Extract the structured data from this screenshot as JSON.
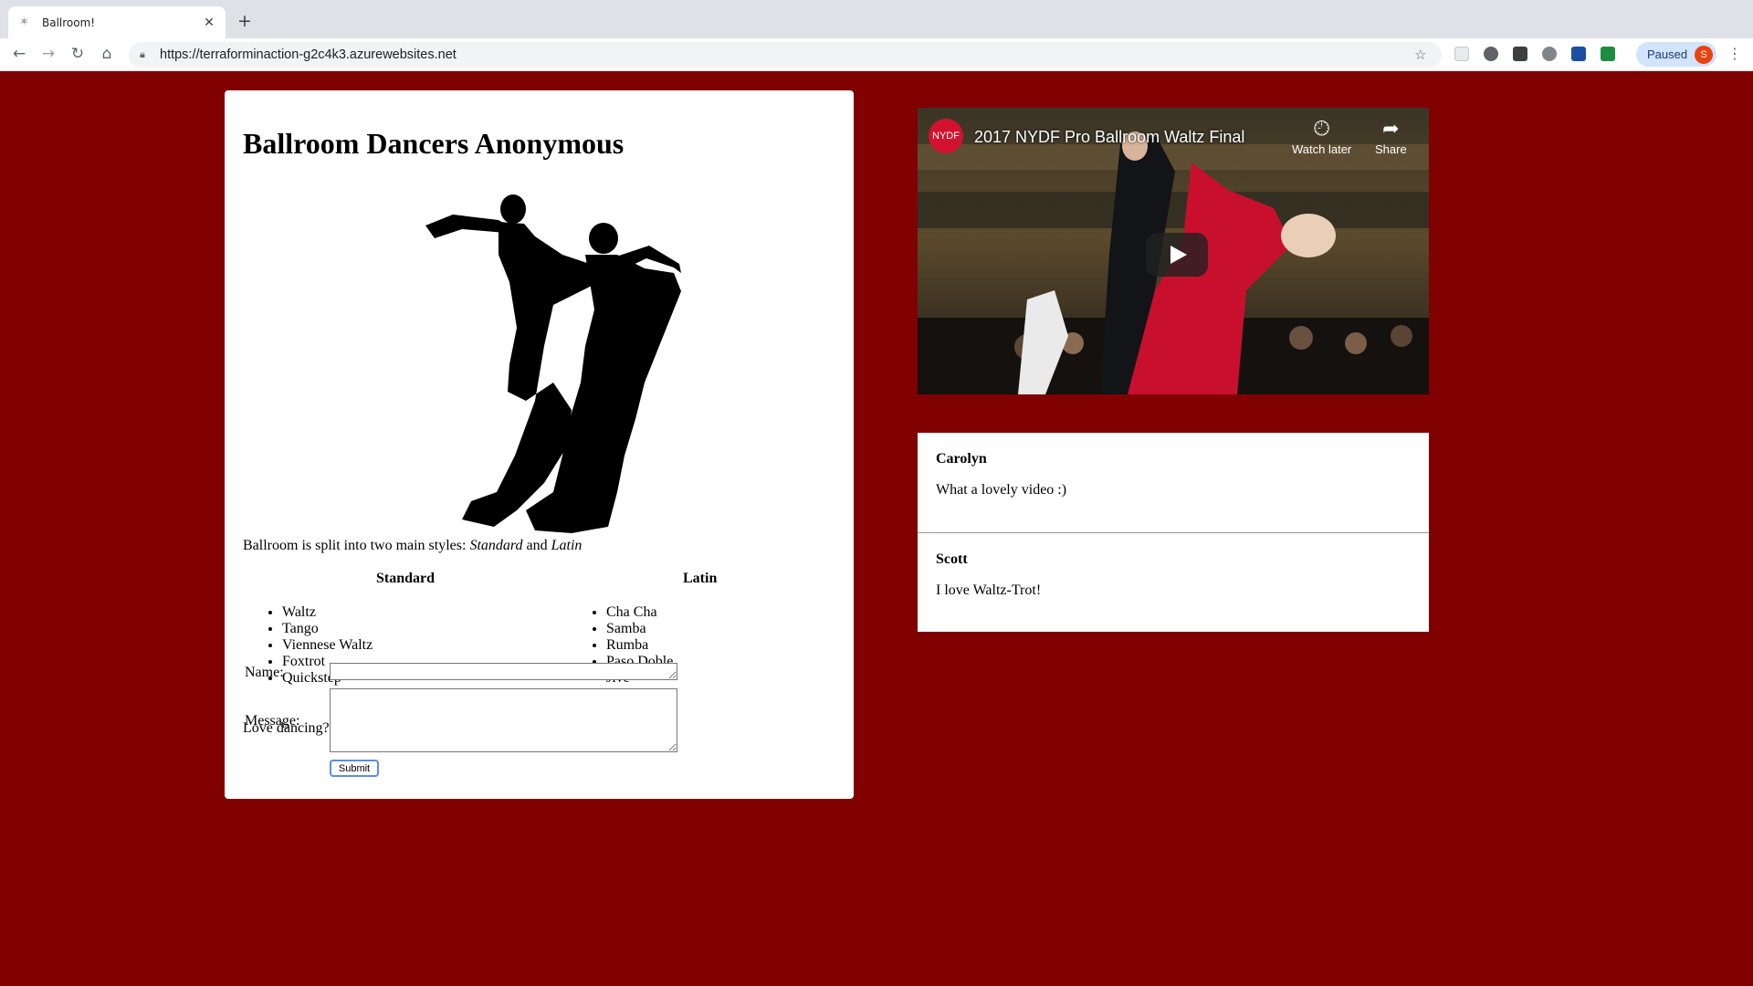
{
  "browser": {
    "tab_title": "Ballroom!",
    "url": "https://terraforminaction-g2c4k3.azurewebsites.net",
    "profile_status": "Paused",
    "profile_initial": "S"
  },
  "page": {
    "heading": "Ballroom Dancers Anonymous",
    "intro_prefix": "Ballroom is split into two main styles: ",
    "intro_style1": "Standard",
    "intro_and": " and ",
    "intro_style2": "Latin",
    "standard": {
      "header": "Standard",
      "items": [
        "Waltz",
        "Tango",
        "Viennese Waltz",
        "Foxtrot",
        "Quickstep"
      ]
    },
    "latin": {
      "header": "Latin",
      "items": [
        "Cha Cha",
        "Samba",
        "Rumba",
        "Paso Doble",
        "Jive"
      ]
    },
    "cta": "Love dancing? Have questions? Leave a comment!",
    "form": {
      "name_label": "Name:",
      "name_value": "",
      "message_label": "Message:",
      "message_value": "",
      "submit_label": "Submit"
    }
  },
  "video": {
    "channel_logo_text": "NYDF",
    "title": "2017 NYDF Pro Ballroom Waltz Final",
    "watch_later": "Watch later",
    "share": "Share"
  },
  "comments": [
    {
      "name": "Carolyn",
      "text": "What a lovely video :)"
    },
    {
      "name": "Scott",
      "text": "I love Waltz-Trot!"
    }
  ]
}
